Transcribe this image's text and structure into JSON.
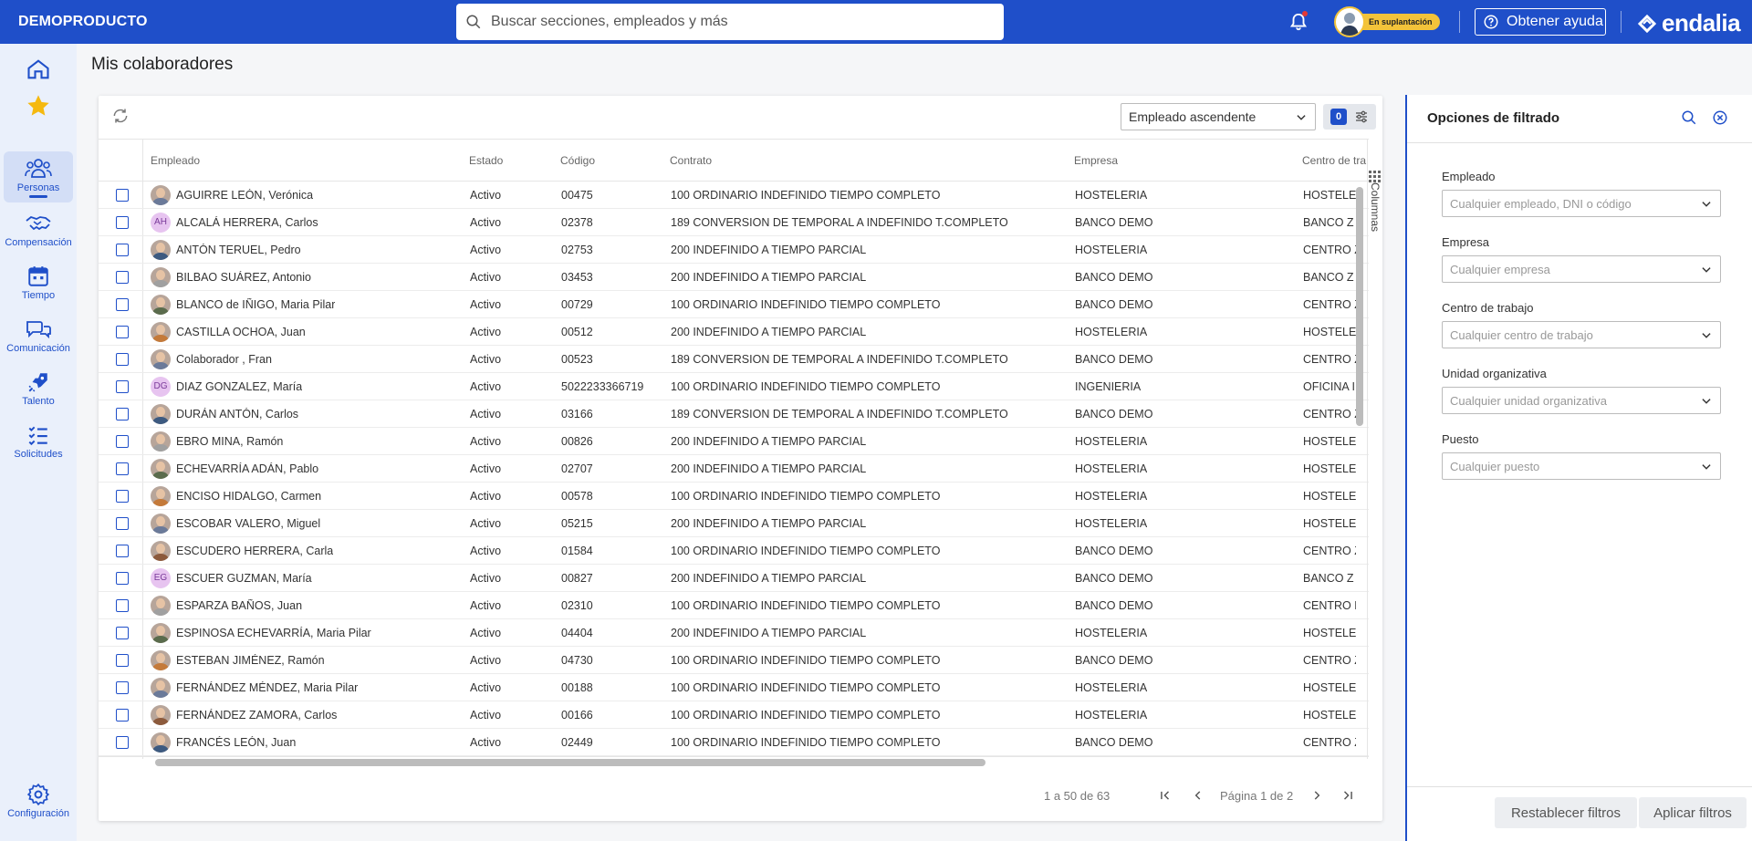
{
  "header": {
    "brand": "DEMOPRODUCTO",
    "search_placeholder": "Buscar secciones, empleados y más",
    "impersonation_badge": "En suplantación",
    "help_label": "Obtener ayuda",
    "logo_text": "endalia",
    "brand_color": "#1f4fc9"
  },
  "sidebar": {
    "items": [
      {
        "label": "",
        "icon": "home-icon"
      },
      {
        "label": "",
        "icon": "star-icon"
      },
      {
        "label": "Personas",
        "icon": "people-icon",
        "active": true
      },
      {
        "label": "Compensación",
        "icon": "handshake-icon"
      },
      {
        "label": "Tiempo",
        "icon": "calendar-icon"
      },
      {
        "label": "Comunicación",
        "icon": "chat-icon"
      },
      {
        "label": "Talento",
        "icon": "rocket-icon"
      },
      {
        "label": "Solicitudes",
        "icon": "checklist-icon"
      },
      {
        "label": "Configuración",
        "icon": "gear-icon"
      }
    ]
  },
  "page": {
    "title": "Mis colaboradores",
    "sort_value": "Empleado ascendente",
    "filter_count": "0",
    "columns_label": "Columnas"
  },
  "table": {
    "headers": [
      "Empleado",
      "Estado",
      "Código",
      "Contrato",
      "Empresa",
      "Centro de tra"
    ],
    "rows": [
      {
        "name": "AGUIRRE LEÓN, Verónica",
        "estado": "Activo",
        "codigo": "00475",
        "contrato": "100 ORDINARIO INDEFINIDO TIEMPO COMPLETO",
        "empresa": "HOSTELERIA",
        "centro": "HOSTELE",
        "avatar": "photo"
      },
      {
        "name": "ALCALÁ HERRERA, Carlos",
        "estado": "Activo",
        "codigo": "02378",
        "contrato": "189 CONVERSION DE TEMPORAL A INDEFINIDO T.COMPLETO",
        "empresa": "BANCO DEMO",
        "centro": "BANCO Z",
        "avatar": "AH"
      },
      {
        "name": "ANTÓN TERUEL, Pedro",
        "estado": "Activo",
        "codigo": "02753",
        "contrato": "200 INDEFINIDO A TIEMPO PARCIAL",
        "empresa": "HOSTELERIA",
        "centro": "CENTRO Z",
        "avatar": "photo"
      },
      {
        "name": "BILBAO SUÁREZ, Antonio",
        "estado": "Activo",
        "codigo": "03453",
        "contrato": "200 INDEFINIDO A TIEMPO PARCIAL",
        "empresa": "BANCO DEMO",
        "centro": "BANCO Z",
        "avatar": "photo"
      },
      {
        "name": "BLANCO de IÑIGO, Maria Pilar",
        "estado": "Activo",
        "codigo": "00729",
        "contrato": "100 ORDINARIO INDEFINIDO TIEMPO COMPLETO",
        "empresa": "BANCO DEMO",
        "centro": "CENTRO Z",
        "avatar": "photo"
      },
      {
        "name": "CASTILLA OCHOA, Juan",
        "estado": "Activo",
        "codigo": "00512",
        "contrato": "200 INDEFINIDO A TIEMPO PARCIAL",
        "empresa": "HOSTELERIA",
        "centro": "HOSTELE",
        "avatar": "photo"
      },
      {
        "name": "Colaborador , Fran",
        "estado": "Activo",
        "codigo": "00523",
        "contrato": "189 CONVERSION DE TEMPORAL A INDEFINIDO T.COMPLETO",
        "empresa": "BANCO DEMO",
        "centro": "CENTRO Z",
        "avatar": "photo"
      },
      {
        "name": "DIAZ GONZALEZ, María",
        "estado": "Activo",
        "codigo": "5022233366719",
        "contrato": "100 ORDINARIO INDEFINIDO TIEMPO COMPLETO",
        "empresa": "INGENIERIA",
        "centro": "OFICINA I",
        "avatar": "DG"
      },
      {
        "name": "DURÁN ANTÓN, Carlos",
        "estado": "Activo",
        "codigo": "03166",
        "contrato": "189 CONVERSION DE TEMPORAL A INDEFINIDO T.COMPLETO",
        "empresa": "BANCO DEMO",
        "centro": "CENTRO Z",
        "avatar": "photo"
      },
      {
        "name": "EBRO MINA, Ramón",
        "estado": "Activo",
        "codigo": "00826",
        "contrato": "200 INDEFINIDO A TIEMPO PARCIAL",
        "empresa": "HOSTELERIA",
        "centro": "HOSTELE",
        "avatar": "photo"
      },
      {
        "name": "ECHEVARRÍA ADÁN, Pablo",
        "estado": "Activo",
        "codigo": "02707",
        "contrato": "200 INDEFINIDO A TIEMPO PARCIAL",
        "empresa": "HOSTELERIA",
        "centro": "HOSTELE",
        "avatar": "photo"
      },
      {
        "name": "ENCISO HIDALGO, Carmen",
        "estado": "Activo",
        "codigo": "00578",
        "contrato": "100 ORDINARIO INDEFINIDO TIEMPO COMPLETO",
        "empresa": "HOSTELERIA",
        "centro": "HOSTELE",
        "avatar": "photo"
      },
      {
        "name": "ESCOBAR VALERO, Miguel",
        "estado": "Activo",
        "codigo": "05215",
        "contrato": "200 INDEFINIDO A TIEMPO PARCIAL",
        "empresa": "HOSTELERIA",
        "centro": "HOSTELE",
        "avatar": "photo"
      },
      {
        "name": "ESCUDERO HERRERA, Carla",
        "estado": "Activo",
        "codigo": "01584",
        "contrato": "100 ORDINARIO INDEFINIDO TIEMPO COMPLETO",
        "empresa": "BANCO DEMO",
        "centro": "CENTRO Z",
        "avatar": "photo"
      },
      {
        "name": "ESCUER GUZMAN, María",
        "estado": "Activo",
        "codigo": "00827",
        "contrato": "200 INDEFINIDO A TIEMPO PARCIAL",
        "empresa": "BANCO DEMO",
        "centro": "BANCO Z",
        "avatar": "EG"
      },
      {
        "name": "ESPARZA BAÑOS, Juan",
        "estado": "Activo",
        "codigo": "02310",
        "contrato": "100 ORDINARIO INDEFINIDO TIEMPO COMPLETO",
        "empresa": "BANCO DEMO",
        "centro": "CENTRO E",
        "avatar": "photo"
      },
      {
        "name": "ESPINOSA ECHEVARRÍA, Maria Pilar",
        "estado": "Activo",
        "codigo": "04404",
        "contrato": "200 INDEFINIDO A TIEMPO PARCIAL",
        "empresa": "HOSTELERIA",
        "centro": "HOSTELE",
        "avatar": "photo"
      },
      {
        "name": "ESTEBAN JIMÉNEZ, Ramón",
        "estado": "Activo",
        "codigo": "04730",
        "contrato": "100 ORDINARIO INDEFINIDO TIEMPO COMPLETO",
        "empresa": "BANCO DEMO",
        "centro": "CENTRO Z",
        "avatar": "photo"
      },
      {
        "name": "FERNÁNDEZ MÉNDEZ, Maria Pilar",
        "estado": "Activo",
        "codigo": "00188",
        "contrato": "100 ORDINARIO INDEFINIDO TIEMPO COMPLETO",
        "empresa": "HOSTELERIA",
        "centro": "HOSTELE",
        "avatar": "photo"
      },
      {
        "name": "FERNÁNDEZ ZAMORA, Carlos",
        "estado": "Activo",
        "codigo": "00166",
        "contrato": "100 ORDINARIO INDEFINIDO TIEMPO COMPLETO",
        "empresa": "HOSTELERIA",
        "centro": "HOSTELE",
        "avatar": "photo"
      },
      {
        "name": "FRANCÉS LEÓN, Juan",
        "estado": "Activo",
        "codigo": "02449",
        "contrato": "100 ORDINARIO INDEFINIDO TIEMPO COMPLETO",
        "empresa": "BANCO DEMO",
        "centro": "CENTRO Z",
        "avatar": "photo"
      }
    ]
  },
  "pagination": {
    "range": "1 a 50 de 63",
    "page": "Página 1 de 2"
  },
  "filters": {
    "title": "Opciones de filtrado",
    "fields": [
      {
        "label": "Empleado",
        "placeholder": "Cualquier empleado, DNI o código"
      },
      {
        "label": "Empresa",
        "placeholder": "Cualquier empresa"
      },
      {
        "label": "Centro de trabajo",
        "placeholder": "Cualquier centro de trabajo"
      },
      {
        "label": "Unidad organizativa",
        "placeholder": "Cualquier unidad organizativa"
      },
      {
        "label": "Puesto",
        "placeholder": "Cualquier puesto"
      }
    ],
    "reset_label": "Restablecer filtros",
    "apply_label": "Aplicar filtros"
  }
}
